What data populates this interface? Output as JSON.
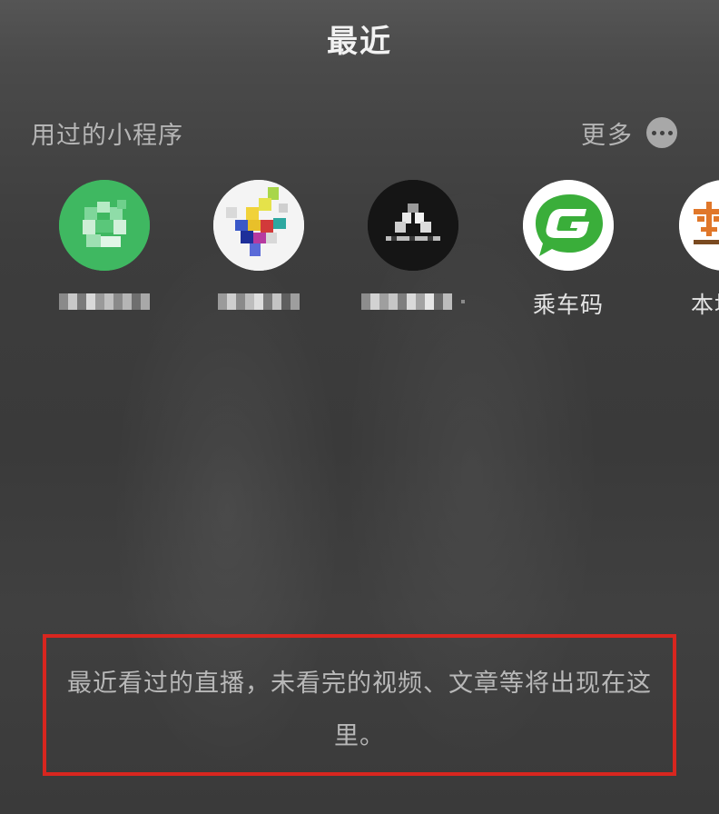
{
  "header": {
    "title": "最近"
  },
  "mini_programs": {
    "section_title": "用过的小程序",
    "more_label": "更多",
    "more_icon": "more-dots-icon",
    "items": [
      {
        "name": "",
        "icon": "green-mini-program-icon",
        "name_pixelated": true
      },
      {
        "name": "",
        "icon": "colorful-mini-program-icon",
        "name_pixelated": true
      },
      {
        "name": "",
        "icon": "black-mini-program-icon",
        "name_pixelated": true
      },
      {
        "name": "乘车码",
        "icon": "ride-code-icon",
        "name_pixelated": false
      },
      {
        "name": "本地",
        "icon": "bendi-icon",
        "name_pixelated": false
      }
    ]
  },
  "empty_state": {
    "message": "最近看过的直播，未看完的视频、文章等将出现在这里。",
    "highlight_color": "#d8261f"
  },
  "colors": {
    "ride_code_green": "#3aae3a",
    "local_orange": "#e0772a"
  }
}
